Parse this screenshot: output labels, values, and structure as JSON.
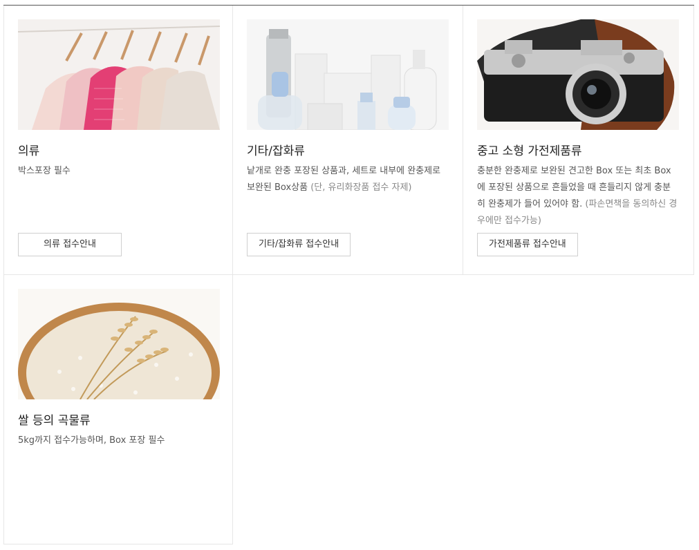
{
  "items": [
    {
      "title": "의류",
      "desc": "박스포장 필수",
      "desc_muted": "",
      "button": "의류 접수안내",
      "image_icon": "clothes-on-hangers"
    },
    {
      "title": "기타/잡화류",
      "desc": "낱개로 완충 포장된 상품과, 세트로 내부에 완충제로 보완된 Box상품 ",
      "desc_muted": "(단, 유리화장품 접수 자제)",
      "button": "기타/잡화류 접수안내",
      "image_icon": "cosmetic-bottles"
    },
    {
      "title": "중고 소형 가전제품류",
      "desc": "충분한 완충제로 보완된 견고한 Box 또는 최초 Box에 포장된 상품으로 흔들었을 때 흔들리지 않게 충분히 완충제가 들어 있어야 함. ",
      "desc_muted": "(파손면책을 동의하신 경우에만 접수가능)",
      "button": "가전제품류 접수안내",
      "image_icon": "vintage-camera"
    },
    {
      "title": "쌀 등의 곡물류",
      "desc": "5kg까지 접수가능하며, Box 포장 필수",
      "desc_muted": "",
      "button": "",
      "image_icon": "rice-basket"
    }
  ],
  "colors": {
    "border": "#e6e6e6",
    "top_rule": "#555555",
    "text": "#222222",
    "muted": "#888888"
  }
}
